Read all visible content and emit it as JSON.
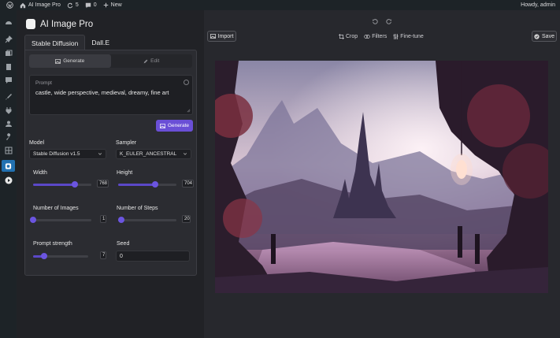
{
  "admin_bar": {
    "site_name": "AI Image Pro",
    "updates_count": "5",
    "comments_count": "0",
    "new_label": "New",
    "howdy": "Howdy, admin"
  },
  "app": {
    "title": "AI Image Pro"
  },
  "tabs": [
    {
      "label": "Stable Diffusion",
      "active": true
    },
    {
      "label": "Dall.E",
      "active": false
    }
  ],
  "modes": {
    "generate": "Generate",
    "edit": "Edit"
  },
  "prompt": {
    "label": "Prompt",
    "value": "castle, wide perspective, medieval, dreamy, fine art"
  },
  "generate_button": "Generate",
  "model": {
    "label": "Model",
    "value": "Stable Diffusion v1.5"
  },
  "sampler": {
    "label": "Sampler",
    "value": "K_EULER_ANCESTRAL"
  },
  "width": {
    "label": "Width",
    "value": "768",
    "level": 0.72
  },
  "height": {
    "label": "Height",
    "value": "704",
    "level": 0.63
  },
  "num_images": {
    "label": "Number of Images",
    "value": "1",
    "level": 0.0
  },
  "num_steps": {
    "label": "Number of Steps",
    "value": "20",
    "level": 0.05
  },
  "prompt_strength": {
    "label": "Prompt strength",
    "value": "7",
    "level": 0.2
  },
  "seed": {
    "label": "Seed",
    "value": "0"
  },
  "toolbar": {
    "import": "Import",
    "crop": "Crop",
    "filters": "Filters",
    "finetune": "Fine-tune",
    "save": "Save"
  },
  "colors": {
    "accent": "#6a4fd6",
    "wp_active": "#2271b1"
  }
}
